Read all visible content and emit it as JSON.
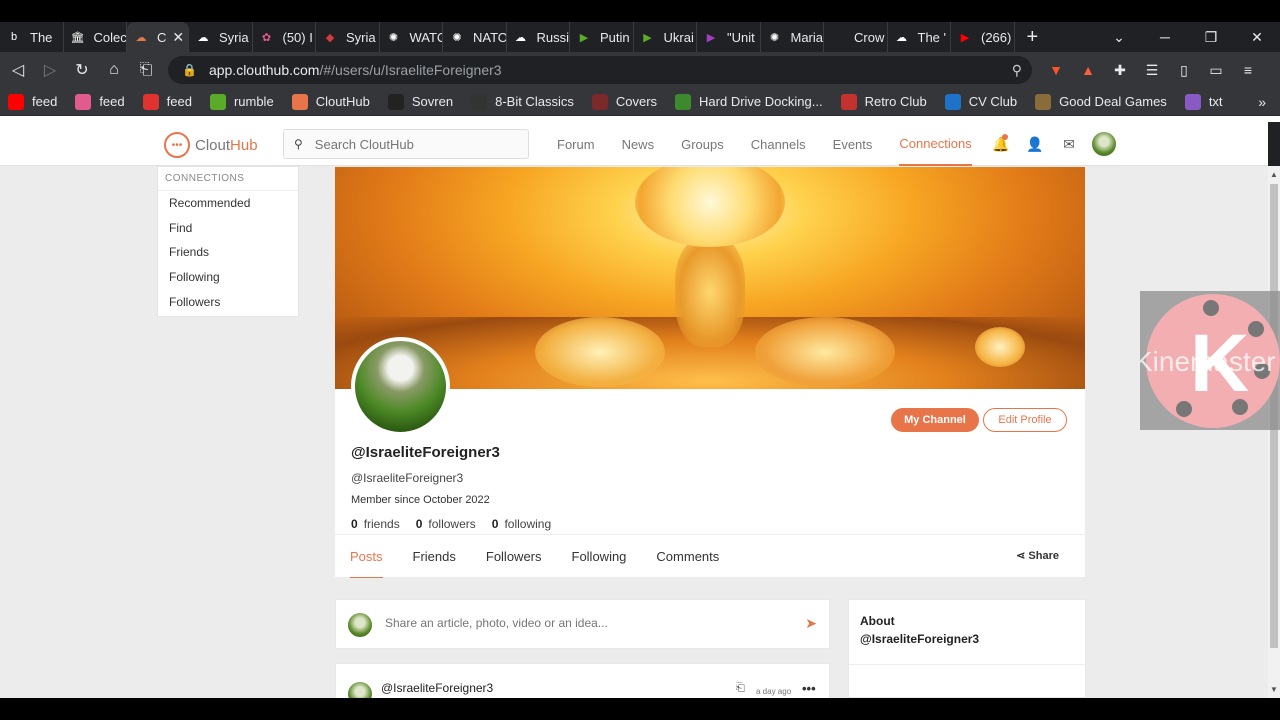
{
  "browser": {
    "tabs": [
      {
        "label": "The",
        "icon": "b",
        "color": "#ffffff"
      },
      {
        "label": "Colec",
        "icon": "🏛",
        "color": "#ffffff"
      },
      {
        "label": "C",
        "icon": "☁",
        "color": "#e8754a",
        "active": true
      },
      {
        "label": "Syria",
        "icon": "☁",
        "color": "#ffffff"
      },
      {
        "label": "(50) I",
        "icon": "✿",
        "color": "#e25b8f"
      },
      {
        "label": "Syria",
        "icon": "◆",
        "color": "#d23c3c"
      },
      {
        "label": "WATC",
        "icon": "✺",
        "color": "#ffffff"
      },
      {
        "label": "NATO",
        "icon": "✺",
        "color": "#ffffff"
      },
      {
        "label": "Russi",
        "icon": "☁",
        "color": "#ffffff"
      },
      {
        "label": "Putin",
        "icon": "▶",
        "color": "#5aab2a"
      },
      {
        "label": "Ukrai",
        "icon": "▶",
        "color": "#5aab2a"
      },
      {
        "label": "\"Unit",
        "icon": "▶",
        "color": "#a43ec4"
      },
      {
        "label": "Maria",
        "icon": "✺",
        "color": "#ffffff"
      },
      {
        "label": "Crow",
        "icon": "",
        "color": "#ffffff"
      },
      {
        "label": "The '",
        "icon": "☁",
        "color": "#ffffff"
      },
      {
        "label": "(266)",
        "icon": "▶",
        "color": "#ff0000"
      }
    ],
    "url_host": "app.clouthub.com",
    "url_path": "/#/users/u/IsraeliteForeigner3",
    "bookmarks": [
      {
        "label": "feed",
        "color": "#ff0000"
      },
      {
        "label": "feed",
        "color": "#e25b8f"
      },
      {
        "label": "feed",
        "color": "#e0322f"
      },
      {
        "label": "rumble",
        "color": "#5aab2a"
      },
      {
        "label": "CloutHub",
        "color": "#e8754a"
      },
      {
        "label": "Sovren",
        "color": "#222222"
      },
      {
        "label": "8-Bit Classics",
        "color": "#333333"
      },
      {
        "label": "Covers",
        "color": "#7a2a2a"
      },
      {
        "label": "Hard Drive Docking...",
        "color": "#3d8a2e"
      },
      {
        "label": "Retro Club",
        "color": "#c4322f"
      },
      {
        "label": "CV Club",
        "color": "#1e73c9"
      },
      {
        "label": "Good Deal Games",
        "color": "#8a6b3a"
      },
      {
        "label": "txt",
        "color": "#8a5ac4"
      }
    ]
  },
  "site": {
    "logo": "CloutHub",
    "search_placeholder": "Search CloutHub",
    "nav": [
      "Forum",
      "News",
      "Groups",
      "Channels",
      "Events",
      "Connections"
    ],
    "active_nav": "Connections"
  },
  "sidemenu": {
    "heading": "CONNECTIONS",
    "items": [
      "Recommended",
      "Find",
      "Friends",
      "Following",
      "Followers"
    ]
  },
  "profile": {
    "name": "@IsraeliteForeigner3",
    "handle": "@IsraeliteForeigner3",
    "member_since": "Member since October 2022",
    "friends_count": "0",
    "friends_label": "friends",
    "followers_count": "0",
    "followers_label": "followers",
    "following_count": "0",
    "following_label": "following",
    "my_channel": "My Channel",
    "edit_profile": "Edit Profile",
    "tabs": [
      "Posts",
      "Friends",
      "Followers",
      "Following",
      "Comments"
    ],
    "share": "Share"
  },
  "composer": {
    "placeholder": "Share an article, photo, video or an idea..."
  },
  "post": {
    "author": "@IsraeliteForeigner3",
    "time": "a day ago"
  },
  "about": {
    "title": "About",
    "name": "@IsraeliteForeigner3"
  },
  "watermark": {
    "letter": "K",
    "text": "Kinemaster"
  }
}
